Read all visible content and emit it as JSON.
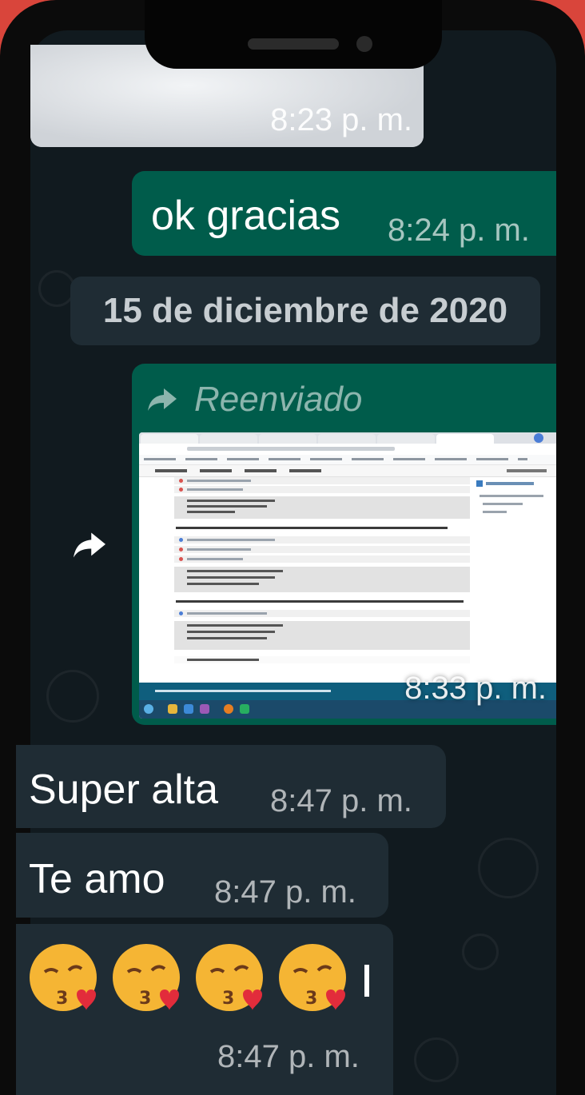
{
  "messages": {
    "image_time": "8:23 p. m.",
    "ok_text": "ok gracias",
    "ok_time": "8:24 p. m.",
    "date_chip": "15 de diciembre de 2020",
    "forwarded_label": "Reenviado",
    "forwarded_time": "8:33 p. m.",
    "super_text": "Super alta",
    "super_time": "8:47 p. m.",
    "teamo_text": "Te amo",
    "teamo_time": "8:47 p. m.",
    "emoji_time": "8:47 p. m.",
    "emoji_count": 4,
    "emoji_name": "face-blowing-a-kiss"
  },
  "colors": {
    "incoming_bubble": "#1f2c34",
    "outgoing_bubble": "#005c4b",
    "chat_background": "#111a1f",
    "phone_case": "#d9453b"
  },
  "icons": {
    "forward": "forward-arrow-icon",
    "share": "share-icon"
  }
}
